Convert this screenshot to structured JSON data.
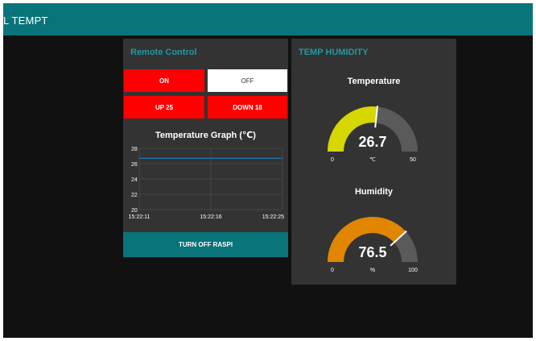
{
  "header": {
    "title": "L TEMPT",
    "color": "#097479"
  },
  "remote_control": {
    "title": "Remote Control",
    "buttons": {
      "on": "ON",
      "off": "OFF",
      "up": "UP 25",
      "down": "DOWN 18"
    },
    "graph": {
      "title": "Temperature Graph (℃)",
      "y_ticks": [
        "28",
        "26",
        "24",
        "22",
        "20"
      ],
      "x_ticks": [
        "15:22:11",
        "15:22:16",
        "15:22:25"
      ]
    },
    "turn_off_label": "TURN OFF RASPI"
  },
  "temp_humidity": {
    "title": "TEMP HUMIDITY",
    "temperature": {
      "label": "Temperature",
      "value": "26.7",
      "unit": "℃",
      "min": "0",
      "max": "50",
      "fill_color": "#d6d600"
    },
    "humidity": {
      "label": "Humidity",
      "value": "76.5",
      "unit": "%",
      "min": "0",
      "max": "100",
      "fill_color": "#e08600"
    }
  },
  "chart_data": {
    "type": "line",
    "title": "Temperature Graph (℃)",
    "x": [
      "15:22:11",
      "15:22:16",
      "15:22:25"
    ],
    "series": [
      {
        "values": [
          26.7,
          26.7,
          26.7
        ]
      }
    ],
    "ylim": [
      20,
      28
    ],
    "grid": true
  }
}
